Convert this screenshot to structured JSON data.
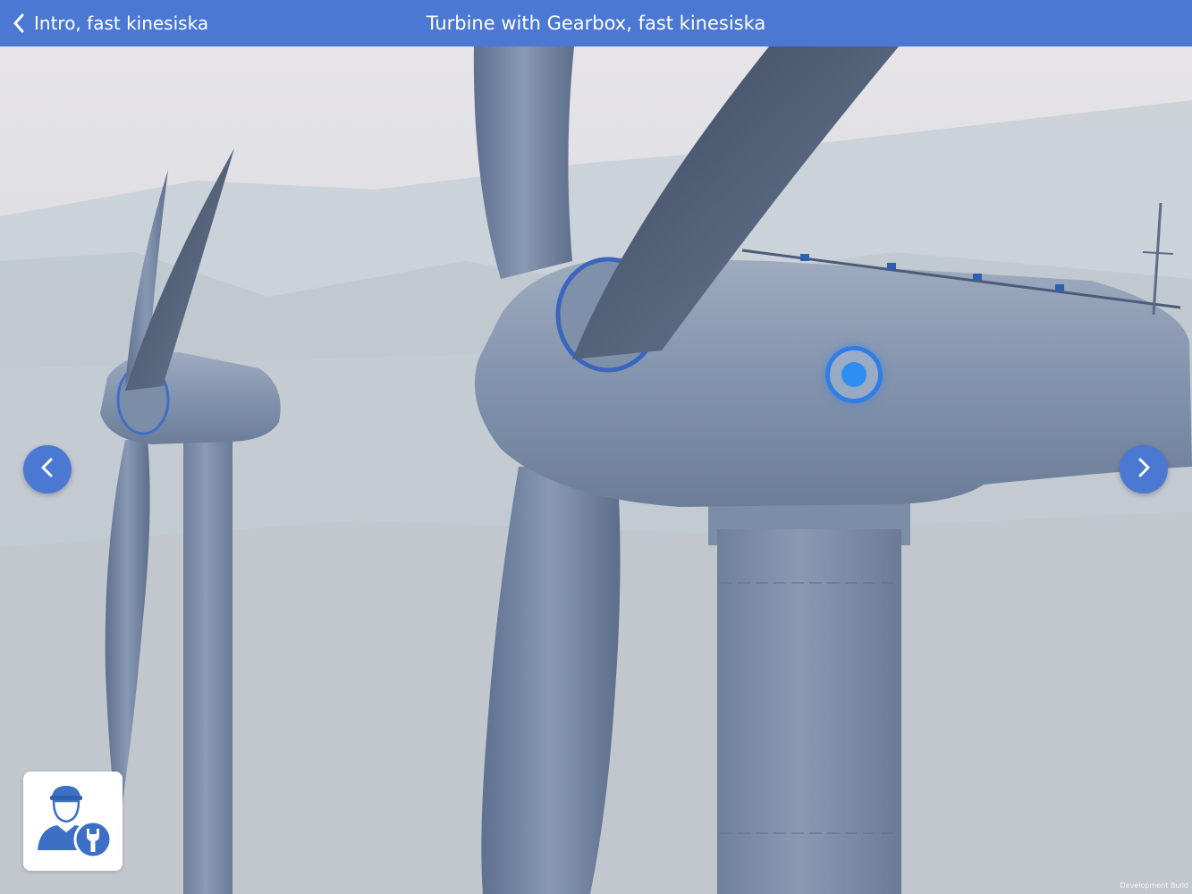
{
  "header": {
    "back_label": "Intro, fast kinesiska",
    "title": "Turbine with Gearbox, fast kinesiska"
  },
  "icons": {
    "back": "chevron-left-icon",
    "prev": "chevron-left-icon",
    "next": "chevron-right-icon",
    "service": "technician-wrench-icon",
    "hotspot": "hotspot-icon"
  },
  "footer": {
    "build_label": "Development Build"
  },
  "colors": {
    "accent": "#4a78d2",
    "hotspot": "#2f8ff0",
    "turbine": "#7d8ea8",
    "sky": "#d9dde2"
  }
}
